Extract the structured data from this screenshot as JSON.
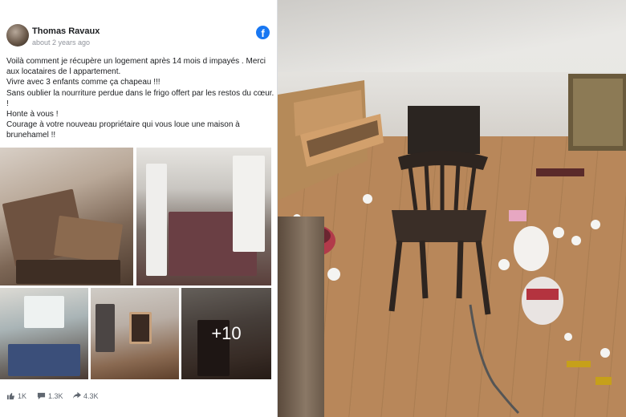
{
  "post": {
    "author": "Thomas Ravaux",
    "time": "about 2 years ago",
    "brand_icon": "facebook-icon",
    "text_lines": [
      "Voilà comment je récupère un logement après 14 mois d impayés . Merci",
      "aux locataires de l appartement.",
      "Vivre avec 3 enfants comme ça chapeau !!!",
      "Sans oublier la nourriture perdue dans le frigo offert par les restos du cœur.",
      "!",
      "Honte à vous !",
      "Courage à votre nouveau propriétaire qui vous loue une maison à",
      "brunehamel !!"
    ],
    "more_photos": "+10",
    "reactions": {
      "likes": "1K",
      "comments": "1.3K",
      "shares": "4.3K"
    }
  },
  "colors": {
    "facebook_blue": "#1877f2",
    "text": "#1c1e21",
    "muted": "#606770"
  }
}
